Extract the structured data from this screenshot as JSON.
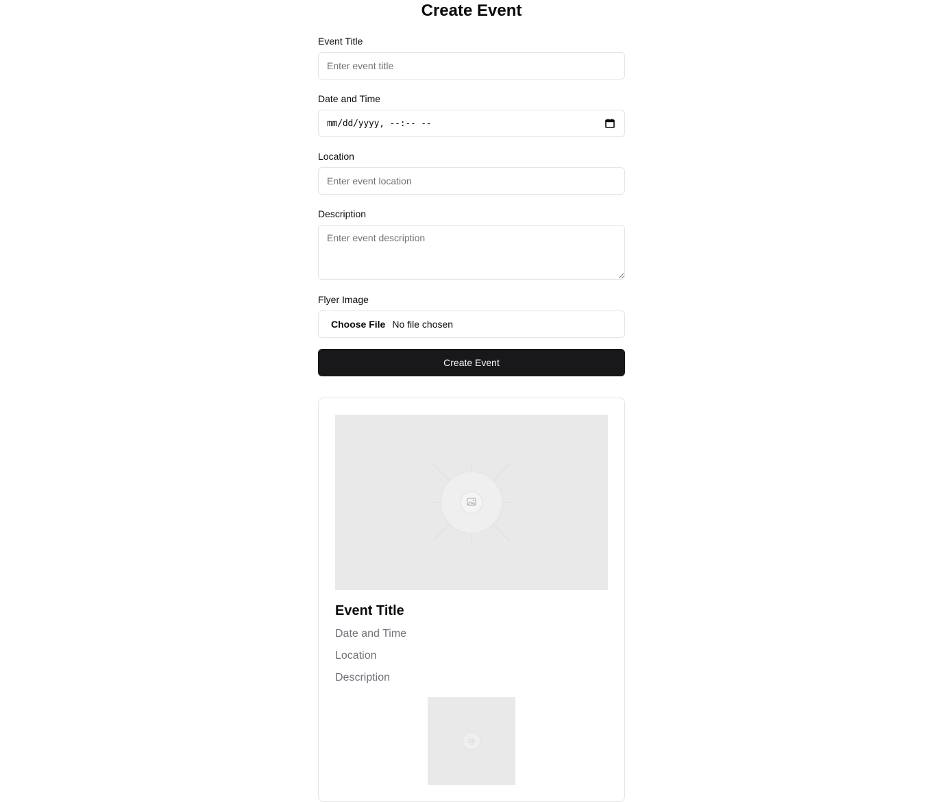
{
  "form": {
    "heading": "Create Event",
    "title_label": "Event Title",
    "title_placeholder": "Enter event title",
    "datetime_label": "Date and Time",
    "datetime_value": "mm/dd/yyyy, --:-- --",
    "location_label": "Location",
    "location_placeholder": "Enter event location",
    "description_label": "Description",
    "description_placeholder": "Enter event description",
    "flyer_label": "Flyer Image",
    "file_button": "Choose File",
    "file_status": "No file chosen",
    "submit_label": "Create Event"
  },
  "preview": {
    "title": "Event Title",
    "datetime": "Date and Time",
    "location": "Location",
    "description": "Description",
    "image_icon": "image-placeholder-icon",
    "thumb_icon": "image-placeholder-icon"
  },
  "colors": {
    "primary_button": "#18181b",
    "placeholder_bg": "#e9e9e9",
    "muted_text": "#71717a",
    "border": "#e4e4e7"
  }
}
